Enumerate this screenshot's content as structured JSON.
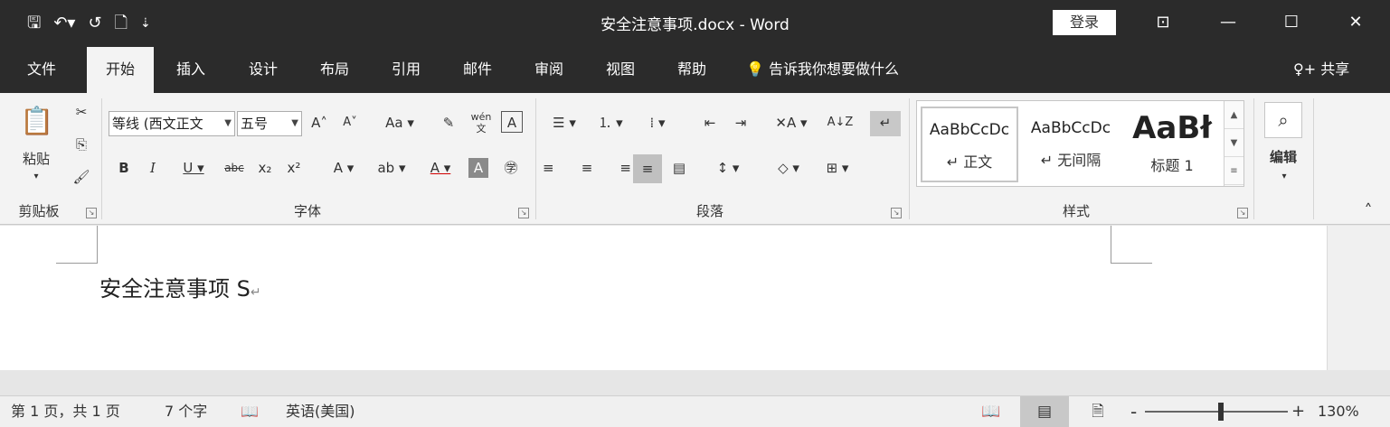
{
  "titlebar": {
    "doc_title": "安全注意事项.docx  -  Word",
    "login": "登录",
    "qat": {
      "save": "🖫",
      "undo": "↶▾",
      "redo": "↺",
      "new": "🗋",
      "customize": "⇣"
    },
    "window": {
      "restore": "⊡",
      "minimize": "—",
      "maximize": "☐",
      "close": "✕"
    }
  },
  "tabs": {
    "items": [
      "文件",
      "开始",
      "插入",
      "设计",
      "布局",
      "引用",
      "邮件",
      "审阅",
      "视图",
      "帮助"
    ],
    "active": "开始",
    "tellme": "💡 告诉我你想要做什么",
    "share": "♀+ 共享"
  },
  "ribbon": {
    "clipboard": {
      "label": "剪贴板",
      "paste": "粘贴",
      "paste_arrow": "▾",
      "cut": "✂",
      "copy": "⎘",
      "format_painter": "🖌"
    },
    "font": {
      "label": "字体",
      "font_name": "等线 (西文正文",
      "font_size": "五号",
      "grow": "A˄",
      "shrink": "A˅",
      "case": "Aa ▾",
      "clear": "✎",
      "phonetic": "wén 文",
      "border_char": "A",
      "bold": "B",
      "italic": "I",
      "underline": "U ▾",
      "strike": "abc",
      "subscript": "x₂",
      "superscript": "x²",
      "effects": "A ▾",
      "highlight": "ab ▾",
      "font_color": "A ▾",
      "shading": "A",
      "enclose": "㊫"
    },
    "paragraph": {
      "label": "段落",
      "bullets": "☰ ▾",
      "numbering": "⒈ ▾",
      "multilevel": "⁞ ▾",
      "decrease_indent": "⇤",
      "increase_indent": "⇥",
      "chinese_layout": "✕A ▾",
      "sort": "A↓Z",
      "show_marks": "↵",
      "align_left": "≡",
      "align_center": "≡",
      "align_right": "≡",
      "justify": "≡",
      "distribute": "▤",
      "line_spacing": "↕ ▾",
      "shading": "◇ ▾",
      "borders": "⊞ ▾"
    },
    "styles": {
      "label": "样式",
      "items": [
        {
          "sample": "AaBbCcDc",
          "name": "↵ 正文"
        },
        {
          "sample": "AaBbCcDc",
          "name": "↵ 无间隔"
        },
        {
          "sample": "AaBł",
          "name": "标题 1"
        }
      ],
      "scroll": [
        "▲",
        "▼",
        "≡"
      ]
    },
    "editing": {
      "label": "编辑",
      "icon": "⌕",
      "arrow": "▾"
    },
    "collapse": "˄"
  },
  "document": {
    "text": "安全注意事项 S",
    "para_mark": "↵"
  },
  "status": {
    "page": "第 1 页，共 1 页",
    "words": "7 个字",
    "proof_icon": "📖",
    "language": "英语(美国)",
    "views": [
      "📖",
      "▤",
      "🗎"
    ],
    "zoom_out": "-",
    "zoom_in": "+",
    "zoom": "130%"
  }
}
